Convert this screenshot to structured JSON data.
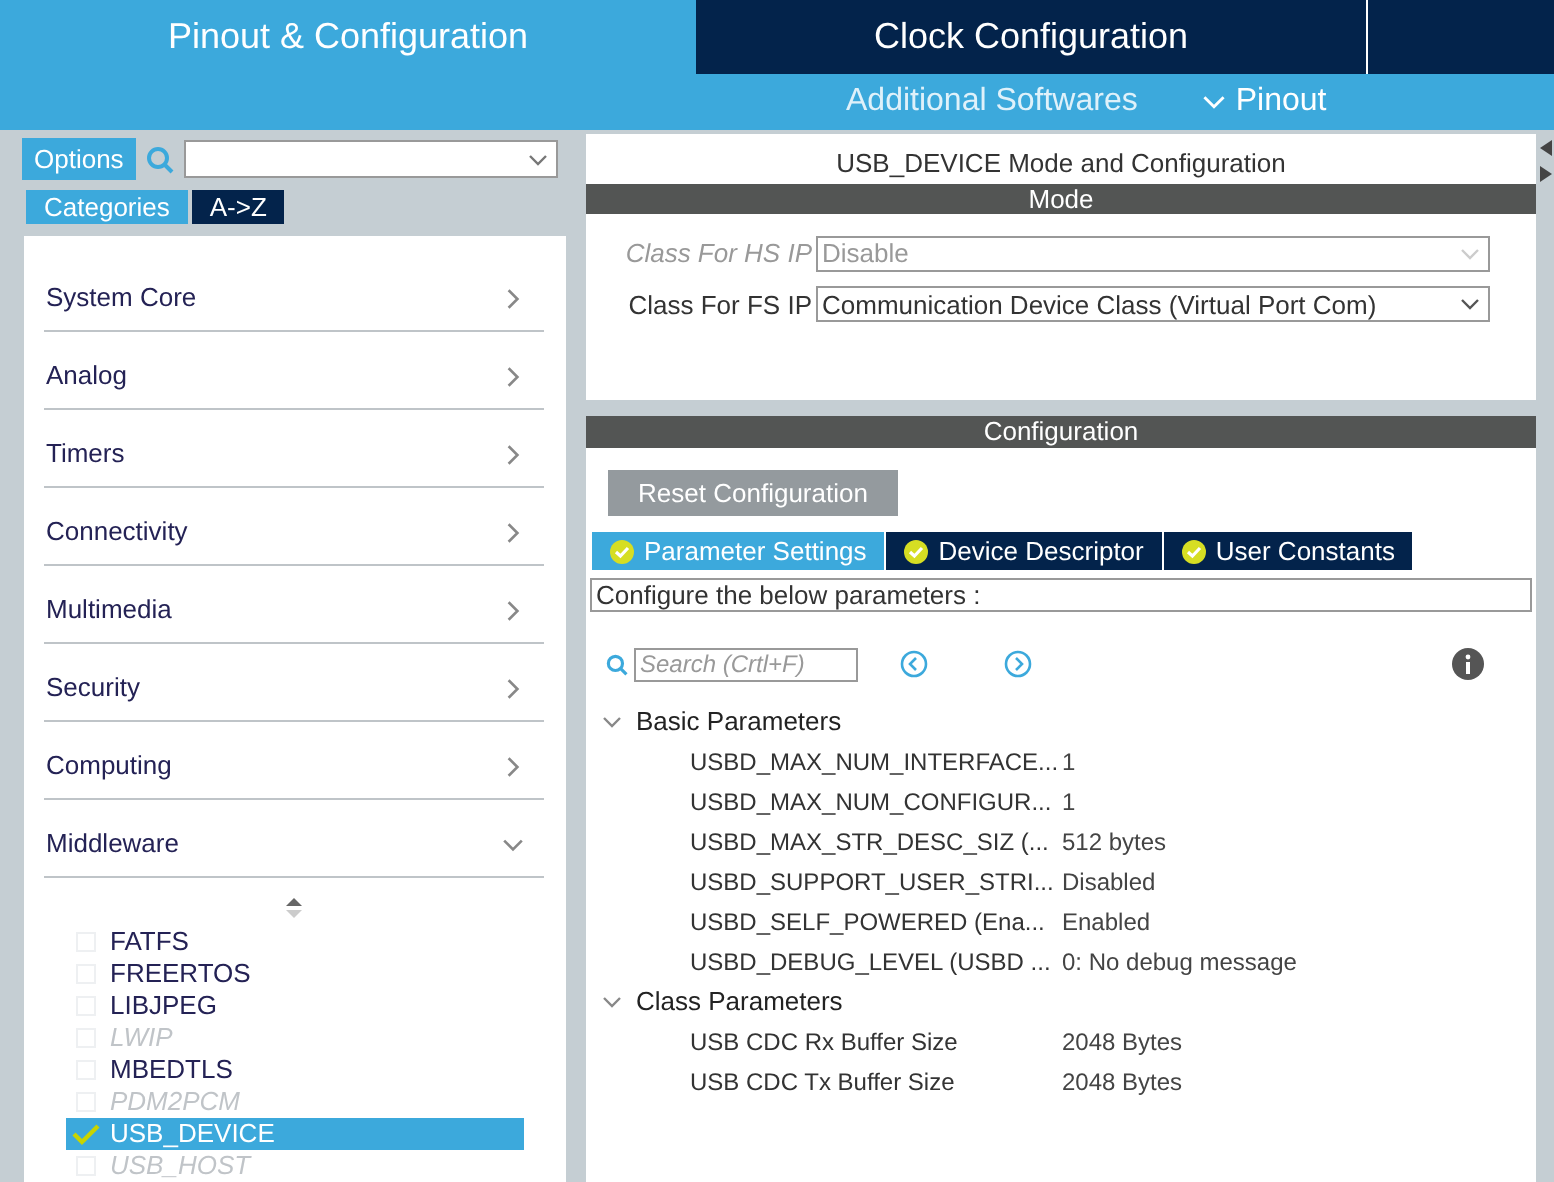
{
  "top_tabs": [
    {
      "label": "Pinout & Configuration",
      "selected": true
    },
    {
      "label": "Clock Configuration",
      "selected": false
    }
  ],
  "sub_bar": {
    "center": "Additional Softwares",
    "right": "Pinout"
  },
  "sidebar": {
    "options_button": "Options",
    "view_tabs": [
      {
        "label": "Categories",
        "selected": true
      },
      {
        "label": "A->Z",
        "selected": false
      }
    ],
    "categories": [
      {
        "label": "System Core",
        "expanded": false
      },
      {
        "label": "Analog",
        "expanded": false
      },
      {
        "label": "Timers",
        "expanded": false
      },
      {
        "label": "Connectivity",
        "expanded": false
      },
      {
        "label": "Multimedia",
        "expanded": false
      },
      {
        "label": "Security",
        "expanded": false
      },
      {
        "label": "Computing",
        "expanded": false
      },
      {
        "label": "Middleware",
        "expanded": true,
        "items": [
          {
            "label": "FATFS",
            "checked": false,
            "disabled": false,
            "selected": false
          },
          {
            "label": "FREERTOS",
            "checked": false,
            "disabled": false,
            "selected": false
          },
          {
            "label": "LIBJPEG",
            "checked": false,
            "disabled": false,
            "selected": false
          },
          {
            "label": "LWIP",
            "checked": false,
            "disabled": true,
            "selected": false
          },
          {
            "label": "MBEDTLS",
            "checked": false,
            "disabled": false,
            "selected": false
          },
          {
            "label": "PDM2PCM",
            "checked": false,
            "disabled": true,
            "selected": false
          },
          {
            "label": "USB_DEVICE",
            "checked": true,
            "disabled": false,
            "selected": true
          },
          {
            "label": "USB_HOST",
            "checked": false,
            "disabled": true,
            "selected": false
          }
        ]
      }
    ]
  },
  "mode_panel": {
    "title": "USB_DEVICE Mode and Configuration",
    "header": "Mode",
    "fields": [
      {
        "label": "Class For HS IP",
        "value": "Disable",
        "disabled": true
      },
      {
        "label": "Class For FS IP",
        "value": "Communication Device Class (Virtual Port Com)",
        "disabled": false
      }
    ]
  },
  "config_panel": {
    "header": "Configuration",
    "reset_button": "Reset Configuration",
    "tabs": [
      {
        "label": "Parameter Settings",
        "selected": true
      },
      {
        "label": "Device Descriptor",
        "selected": false
      },
      {
        "label": "User Constants",
        "selected": false
      }
    ],
    "description": "Configure the below parameters :",
    "search": {
      "placeholder": "Search (Crtl+F)"
    },
    "groups": [
      {
        "label": "Basic Parameters",
        "expanded": true,
        "params": [
          {
            "name": "USBD_MAX_NUM_INTERFACE...",
            "value": "1"
          },
          {
            "name": "USBD_MAX_NUM_CONFIGUR...",
            "value": "1"
          },
          {
            "name": "USBD_MAX_STR_DESC_SIZ (...",
            "value": "512 bytes"
          },
          {
            "name": "USBD_SUPPORT_USER_STRI...",
            "value": "Disabled"
          },
          {
            "name": "USBD_SELF_POWERED (Ena...",
            "value": "Enabled"
          },
          {
            "name": "USBD_DEBUG_LEVEL (USBD ...",
            "value": "0: No debug message"
          }
        ]
      },
      {
        "label": "Class Parameters",
        "expanded": true,
        "params": [
          {
            "name": "USB CDC Rx Buffer Size",
            "value": "2048 Bytes"
          },
          {
            "name": "USB CDC Tx Buffer Size",
            "value": "2048 Bytes"
          }
        ]
      }
    ]
  }
}
